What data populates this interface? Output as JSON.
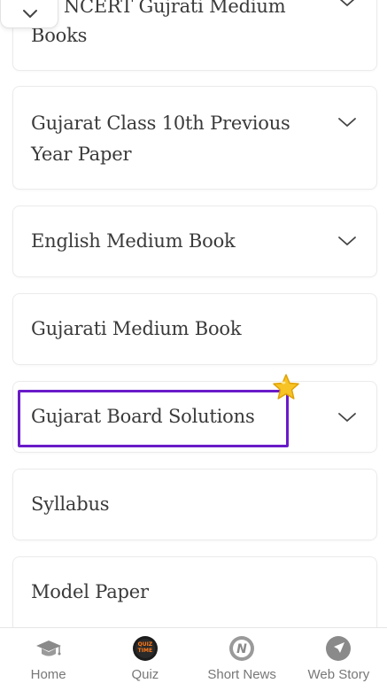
{
  "accordion": {
    "items": [
      {
        "label_line1": "EB NCERT Gujrati Medium",
        "label_line2": "Books",
        "has_chevron": true
      },
      {
        "label_line1": "Gujarat Class 10th Previous",
        "label_line2": "Year Paper",
        "has_chevron": true
      },
      {
        "label": "English Medium Book",
        "has_chevron": true
      },
      {
        "label": "Gujarati Medium Book",
        "has_chevron": false
      },
      {
        "label": "Gujarat Board Solutions",
        "has_chevron": true,
        "highlighted": true
      },
      {
        "label": "Syllabus",
        "has_chevron": false
      },
      {
        "label": "Model Paper",
        "has_chevron": false
      }
    ]
  },
  "colors": {
    "highlight": "#6a1bc9",
    "title_text": "#3a3a3a",
    "nav_text": "#777777",
    "star": "#f5c518"
  },
  "bottom_nav": {
    "items": [
      {
        "label": "Home",
        "icon": "graduation-cap-icon"
      },
      {
        "label": "Quiz",
        "icon": "quiz-time-icon"
      },
      {
        "label": "Short News",
        "icon": "news-n-icon"
      },
      {
        "label": "Web Story",
        "icon": "compass-icon"
      }
    ]
  },
  "quiz_badge_text": "QUIZ TIME"
}
